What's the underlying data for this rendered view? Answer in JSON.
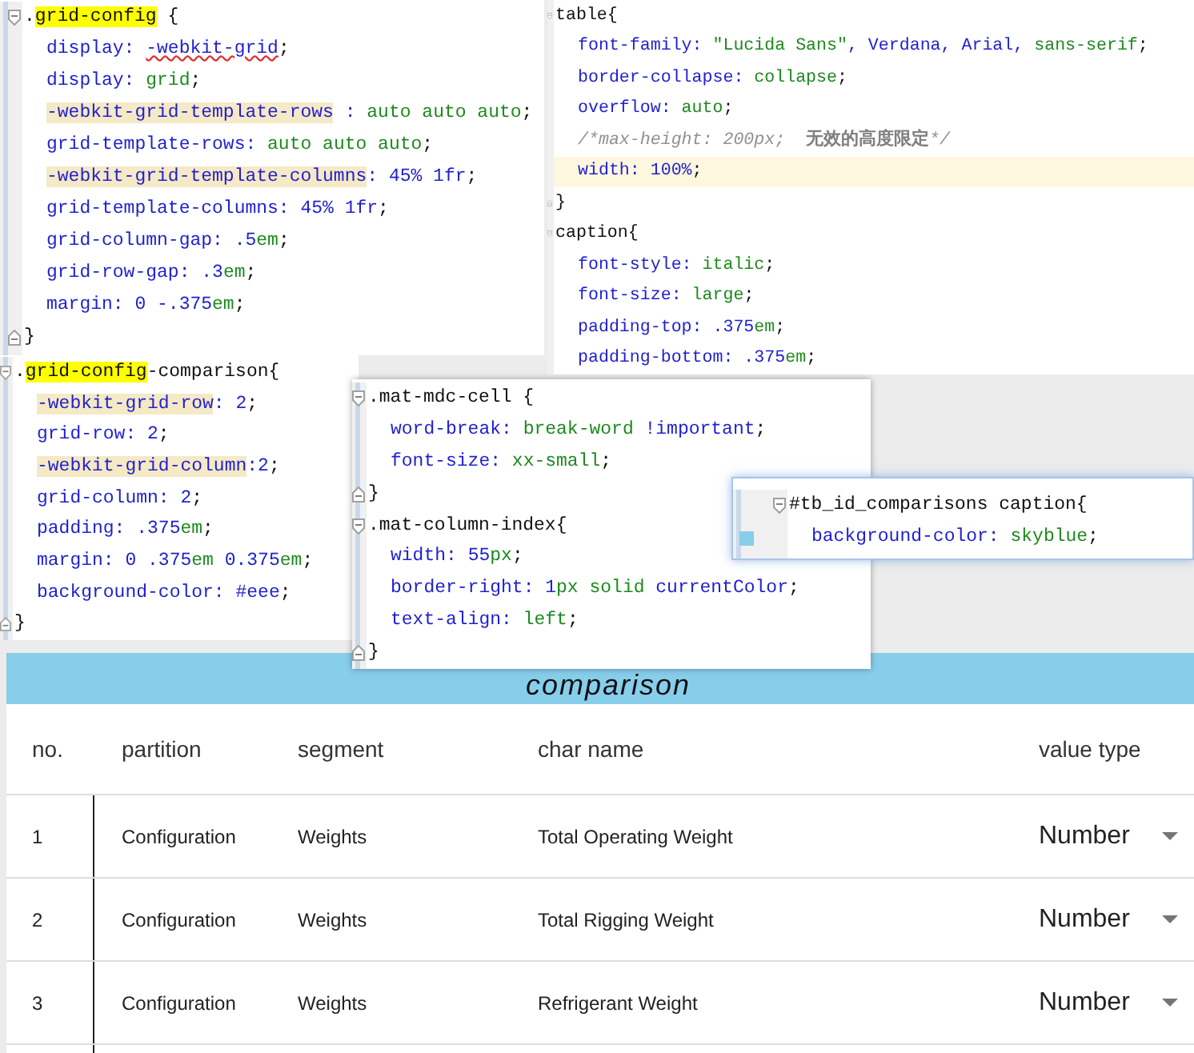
{
  "editors": [
    {
      "lines": [
        {
          "kind": "open",
          "tokens": [
            {
              "kind": "punct",
              "text": "."
            },
            {
              "kind": "sel-hit",
              "text": "grid-config"
            },
            {
              "kind": "sel",
              "text": " {"
            }
          ]
        },
        {
          "kind": "body",
          "tokens": [
            {
              "kind": "prop",
              "text": "display: "
            },
            {
              "kind": "val-warn",
              "text": "-webkit-grid"
            },
            {
              "kind": "punct",
              "text": ";"
            }
          ]
        },
        {
          "kind": "body",
          "tokens": [
            {
              "kind": "prop",
              "text": "display: "
            },
            {
              "kind": "val",
              "text": "grid"
            },
            {
              "kind": "punct",
              "text": ";"
            }
          ]
        },
        {
          "kind": "body",
          "tokens": [
            {
              "kind": "prop-hit",
              "text": "-webkit-grid-template-rows"
            },
            {
              "kind": "prop",
              "text": " : "
            },
            {
              "kind": "val",
              "text": "auto auto auto"
            },
            {
              "kind": "punct",
              "text": ";"
            }
          ]
        },
        {
          "kind": "body",
          "tokens": [
            {
              "kind": "prop",
              "text": "grid-template-rows: "
            },
            {
              "kind": "val",
              "text": "auto auto auto"
            },
            {
              "kind": "punct",
              "text": ";"
            }
          ]
        },
        {
          "kind": "body",
          "tokens": [
            {
              "kind": "prop-hit",
              "text": "-webkit-grid-template-columns"
            },
            {
              "kind": "prop",
              "text": ": "
            },
            {
              "kind": "num",
              "text": "45% 1fr"
            },
            {
              "kind": "punct",
              "text": ";"
            }
          ]
        },
        {
          "kind": "body",
          "tokens": [
            {
              "kind": "prop",
              "text": "grid-template-columns: "
            },
            {
              "kind": "num",
              "text": "45% 1fr"
            },
            {
              "kind": "punct",
              "text": ";"
            }
          ]
        },
        {
          "kind": "body",
          "tokens": [
            {
              "kind": "prop",
              "text": "grid-column-gap: "
            },
            {
              "kind": "num",
              "text": ".5"
            },
            {
              "kind": "val",
              "text": "em"
            },
            {
              "kind": "punct",
              "text": ";"
            }
          ]
        },
        {
          "kind": "body",
          "tokens": [
            {
              "kind": "prop",
              "text": "grid-row-gap: "
            },
            {
              "kind": "num",
              "text": ".3"
            },
            {
              "kind": "val",
              "text": "em"
            },
            {
              "kind": "punct",
              "text": ";"
            }
          ]
        },
        {
          "kind": "body",
          "tokens": [
            {
              "kind": "prop",
              "text": "margin: "
            },
            {
              "kind": "num",
              "text": "0 -.375"
            },
            {
              "kind": "val",
              "text": "em"
            },
            {
              "kind": "punct",
              "text": ";"
            }
          ]
        },
        {
          "kind": "close",
          "tokens": [
            {
              "kind": "sel",
              "text": "}"
            }
          ]
        }
      ]
    },
    {
      "lines": [
        {
          "kind": "open",
          "tokens": [
            {
              "kind": "sel",
              "text": "table{"
            }
          ]
        },
        {
          "kind": "body",
          "tokens": [
            {
              "kind": "prop",
              "text": "font-family: "
            },
            {
              "kind": "val",
              "text": "\"Lucida Sans\""
            },
            {
              "kind": "num",
              "text": ", Verdana, Arial, "
            },
            {
              "kind": "val",
              "text": "sans-serif"
            },
            {
              "kind": "punct",
              "text": ";"
            }
          ]
        },
        {
          "kind": "body",
          "tokens": [
            {
              "kind": "prop",
              "text": "border-collapse: "
            },
            {
              "kind": "val",
              "text": "collapse"
            },
            {
              "kind": "punct",
              "text": ";"
            }
          ]
        },
        {
          "kind": "body",
          "tokens": [
            {
              "kind": "prop",
              "text": "overflow: "
            },
            {
              "kind": "val",
              "text": "auto"
            },
            {
              "kind": "punct",
              "text": ";"
            }
          ]
        },
        {
          "kind": "body",
          "tokens": [
            {
              "kind": "comment",
              "text": "/*max-height: 200px;  "
            },
            {
              "kind": "comment-cjk",
              "text": "无效的高度限定"
            },
            {
              "kind": "comment",
              "text": "*/"
            }
          ]
        },
        {
          "kind": "current",
          "tokens": [
            {
              "kind": "prop",
              "text": "width: "
            },
            {
              "kind": "num",
              "text": "100%"
            },
            {
              "kind": "punct",
              "text": ";"
            }
          ]
        },
        {
          "kind": "close",
          "tokens": [
            {
              "kind": "sel",
              "text": "}"
            }
          ]
        },
        {
          "kind": "open",
          "tokens": [
            {
              "kind": "sel",
              "text": "caption{"
            }
          ]
        },
        {
          "kind": "body",
          "tokens": [
            {
              "kind": "prop",
              "text": "font-style: "
            },
            {
              "kind": "val",
              "text": "italic"
            },
            {
              "kind": "punct",
              "text": ";"
            }
          ]
        },
        {
          "kind": "body",
          "tokens": [
            {
              "kind": "prop",
              "text": "font-size: "
            },
            {
              "kind": "val",
              "text": "large"
            },
            {
              "kind": "punct",
              "text": ";"
            }
          ]
        },
        {
          "kind": "body",
          "tokens": [
            {
              "kind": "prop",
              "text": "padding-top: "
            },
            {
              "kind": "num",
              "text": ".375"
            },
            {
              "kind": "val",
              "text": "em"
            },
            {
              "kind": "punct",
              "text": ";"
            }
          ]
        },
        {
          "kind": "body",
          "tokens": [
            {
              "kind": "prop",
              "text": "padding-bottom: "
            },
            {
              "kind": "num",
              "text": ".375"
            },
            {
              "kind": "val",
              "text": "em"
            },
            {
              "kind": "punct",
              "text": ";"
            }
          ]
        }
      ]
    },
    {
      "lines": [
        {
          "kind": "open",
          "tokens": [
            {
              "kind": "punct",
              "text": "."
            },
            {
              "kind": "sel-hit",
              "text": "grid-config"
            },
            {
              "kind": "sel",
              "text": "-comparison{"
            }
          ]
        },
        {
          "kind": "body",
          "tokens": [
            {
              "kind": "prop-hit",
              "text": "-webkit-grid-row"
            },
            {
              "kind": "prop",
              "text": ": "
            },
            {
              "kind": "num",
              "text": "2"
            },
            {
              "kind": "punct",
              "text": ";"
            }
          ]
        },
        {
          "kind": "body",
          "tokens": [
            {
              "kind": "prop",
              "text": "grid-row: "
            },
            {
              "kind": "num",
              "text": "2"
            },
            {
              "kind": "punct",
              "text": ";"
            }
          ]
        },
        {
          "kind": "body",
          "tokens": [
            {
              "kind": "prop-hit",
              "text": "-webkit-grid-column"
            },
            {
              "kind": "prop",
              "text": ":"
            },
            {
              "kind": "num",
              "text": "2"
            },
            {
              "kind": "punct",
              "text": ";"
            }
          ]
        },
        {
          "kind": "body",
          "tokens": [
            {
              "kind": "prop",
              "text": "grid-column: "
            },
            {
              "kind": "num",
              "text": "2"
            },
            {
              "kind": "punct",
              "text": ";"
            }
          ]
        },
        {
          "kind": "body",
          "tokens": [
            {
              "kind": "prop",
              "text": "padding: "
            },
            {
              "kind": "num",
              "text": ".375"
            },
            {
              "kind": "val",
              "text": "em"
            },
            {
              "kind": "punct",
              "text": ";"
            }
          ]
        },
        {
          "kind": "body",
          "tokens": [
            {
              "kind": "prop",
              "text": "margin: "
            },
            {
              "kind": "num",
              "text": "0 .375"
            },
            {
              "kind": "val",
              "text": "em"
            },
            {
              "kind": "num",
              "text": " 0.375"
            },
            {
              "kind": "val",
              "text": "em"
            },
            {
              "kind": "punct",
              "text": ";"
            }
          ]
        },
        {
          "kind": "body",
          "tokens": [
            {
              "kind": "prop",
              "text": "background-color: "
            },
            {
              "kind": "num",
              "text": "#eee"
            },
            {
              "kind": "punct",
              "text": ";"
            }
          ]
        },
        {
          "kind": "close",
          "tokens": [
            {
              "kind": "sel",
              "text": "}"
            }
          ]
        }
      ]
    },
    {
      "lines": [
        {
          "kind": "open",
          "tokens": [
            {
              "kind": "sel",
              "text": ".mat-mdc-cell {"
            }
          ]
        },
        {
          "kind": "body",
          "tokens": [
            {
              "kind": "prop",
              "text": "word-break: "
            },
            {
              "kind": "val",
              "text": "break-word"
            },
            {
              "kind": "num",
              "text": " !important"
            },
            {
              "kind": "punct",
              "text": ";"
            }
          ]
        },
        {
          "kind": "body",
          "tokens": [
            {
              "kind": "prop",
              "text": "font-size: "
            },
            {
              "kind": "val",
              "text": "xx-small"
            },
            {
              "kind": "punct",
              "text": ";"
            }
          ]
        },
        {
          "kind": "close",
          "tokens": [
            {
              "kind": "sel",
              "text": "}"
            }
          ]
        },
        {
          "kind": "open",
          "tokens": [
            {
              "kind": "sel",
              "text": ".mat-column-index{"
            }
          ]
        },
        {
          "kind": "body",
          "tokens": [
            {
              "kind": "prop",
              "text": "width: "
            },
            {
              "kind": "num",
              "text": "55"
            },
            {
              "kind": "val",
              "text": "px"
            },
            {
              "kind": "punct",
              "text": ";"
            }
          ]
        },
        {
          "kind": "body",
          "tokens": [
            {
              "kind": "prop",
              "text": "border-right: "
            },
            {
              "kind": "num",
              "text": "1"
            },
            {
              "kind": "val",
              "text": "px solid"
            },
            {
              "kind": "num",
              "text": " currentColor"
            },
            {
              "kind": "punct",
              "text": ";"
            }
          ]
        },
        {
          "kind": "body",
          "tokens": [
            {
              "kind": "prop",
              "text": "text-align: "
            },
            {
              "kind": "val",
              "text": "left"
            },
            {
              "kind": "punct",
              "text": ";"
            }
          ]
        },
        {
          "kind": "close",
          "tokens": [
            {
              "kind": "sel",
              "text": "}"
            }
          ]
        }
      ]
    },
    {
      "lines": [
        {
          "kind": "open",
          "tokens": [
            {
              "kind": "sel",
              "text": "#tb_id_comparisons caption{"
            }
          ]
        },
        {
          "kind": "body",
          "color": "#87ceeb",
          "tokens": [
            {
              "kind": "prop",
              "text": "background-color: "
            },
            {
              "kind": "val",
              "text": "skyblue"
            },
            {
              "kind": "punct",
              "text": ";"
            }
          ]
        }
      ]
    }
  ],
  "table": {
    "caption": "comparison",
    "columns": [
      "no.",
      "partition",
      "segment",
      "char name",
      "value type"
    ],
    "rows": [
      {
        "cells": [
          "1",
          "Configuration",
          "Weights",
          "Total Operating Weight"
        ],
        "value_type": "Number"
      },
      {
        "cells": [
          "2",
          "Configuration",
          "Weights",
          "Total Rigging Weight"
        ],
        "value_type": "Number"
      },
      {
        "cells": [
          "3",
          "Configuration",
          "Weights",
          "Refrigerant Weight"
        ],
        "value_type": "Number"
      }
    ]
  }
}
